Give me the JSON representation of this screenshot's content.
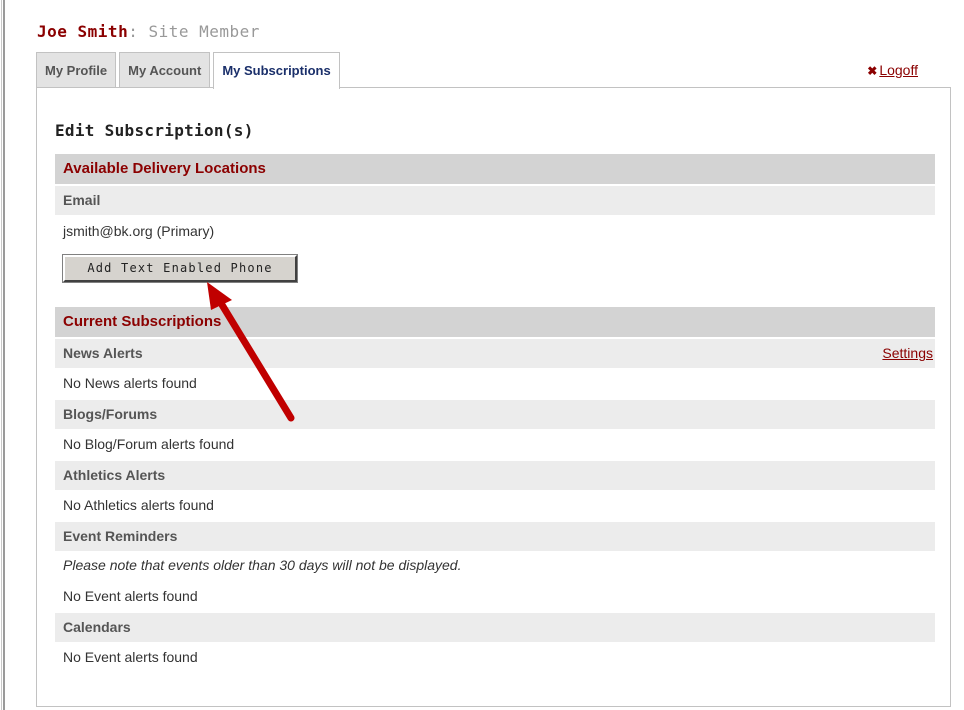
{
  "header": {
    "user_name": "Joe Smith",
    "role": ": Site Member"
  },
  "tabs": [
    {
      "label": "My Profile"
    },
    {
      "label": "My Account"
    },
    {
      "label": "My Subscriptions"
    }
  ],
  "logoff": {
    "icon": "x-icon",
    "label": "Logoff"
  },
  "panel": {
    "title": "Edit Subscription(s)"
  },
  "delivery": {
    "section_title": "Available Delivery Locations",
    "email_header": "Email",
    "email_value": "jsmith@bk.org  (Primary)",
    "add_phone_label": "Add Text Enabled Phone"
  },
  "subscriptions": {
    "section_title": "Current Subscriptions",
    "settings_label": "Settings",
    "groups": [
      {
        "header": "News Alerts",
        "text": "No News alerts found"
      },
      {
        "header": "Blogs/Forums",
        "text": "No Blog/Forum alerts found"
      },
      {
        "header": "Athletics Alerts",
        "text": "No Athletics alerts found"
      },
      {
        "header": "Event Reminders",
        "note": "Please note that events older than 30 days will not be displayed.",
        "text": "No Event alerts found"
      },
      {
        "header": "Calendars",
        "text": "No Event alerts found"
      }
    ]
  },
  "colors": {
    "brand_red": "#8b0000",
    "tab_active_text": "#1a2f6a",
    "annotation_arrow": "#c00000"
  }
}
